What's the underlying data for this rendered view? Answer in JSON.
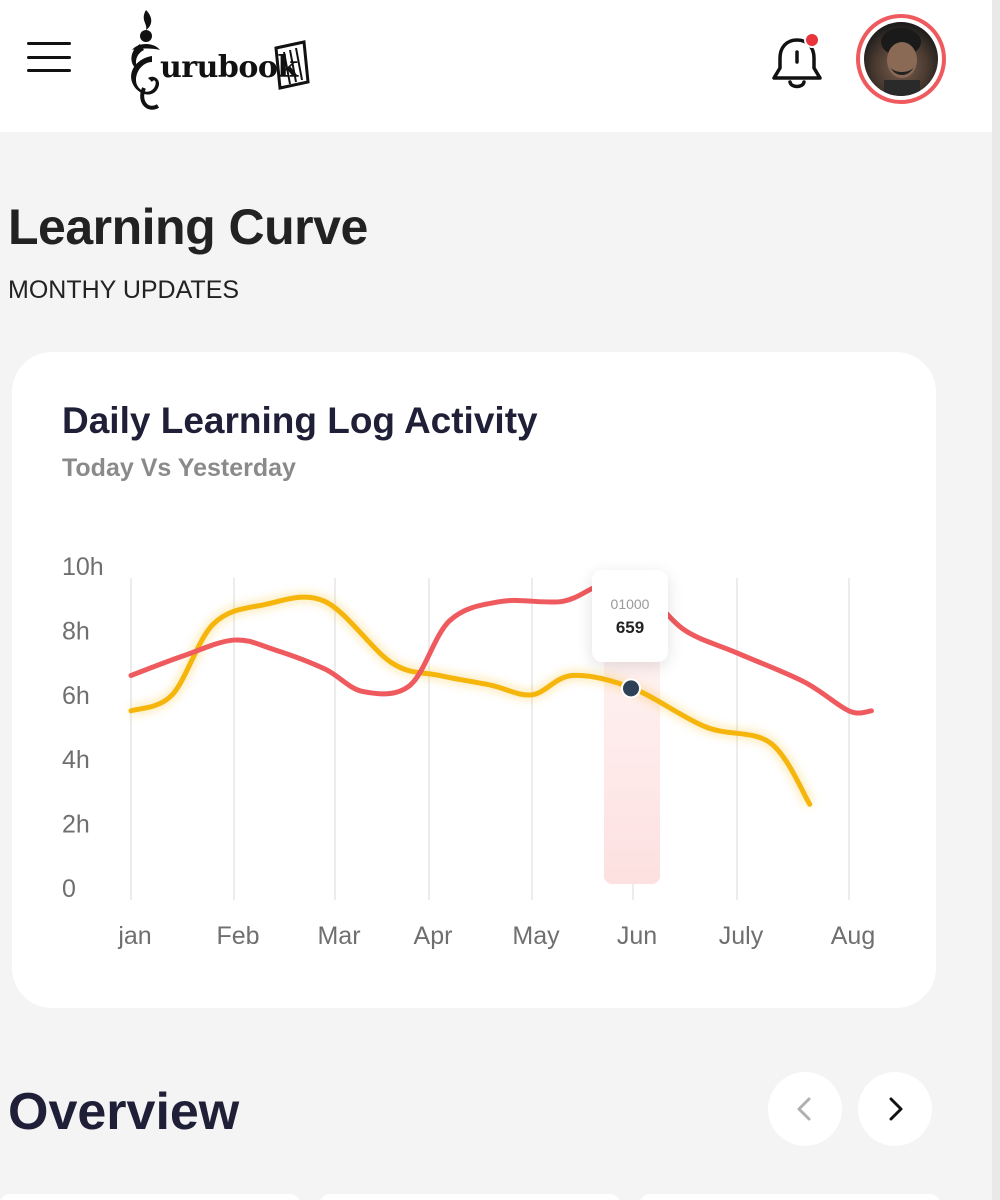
{
  "header": {
    "logo_text": "urubook",
    "has_notification": true
  },
  "page": {
    "title": "Learning Curve",
    "subtitle": "MONTHY UPDATES"
  },
  "card": {
    "title": "Daily Learning Log Activity",
    "subtitle": "Today Vs Yesterday"
  },
  "tooltip": {
    "label": "01000",
    "value": "659"
  },
  "colors": {
    "today": "#f5b50a",
    "yesterday": "#ef5a5e",
    "marker": "#2d4257",
    "highlight": "#fde3e3"
  },
  "chart_data": {
    "type": "line",
    "categories": [
      "jan",
      "Feb",
      "Mar",
      "Apr",
      "May",
      "Jun",
      "July",
      "Aug"
    ],
    "y_tick_labels": [
      "10h",
      "8h",
      "6h",
      "4h",
      "2h",
      "0"
    ],
    "ylim": [
      0,
      10
    ],
    "series": [
      {
        "color": "#f5b50a",
        "points": [
          [
            0,
            5.5
          ],
          [
            0.4,
            6.0
          ],
          [
            0.8,
            8.2
          ],
          [
            1.3,
            8.8
          ],
          [
            1.9,
            8.9
          ],
          [
            2.6,
            7.0
          ],
          [
            3.1,
            6.6
          ],
          [
            3.6,
            6.3
          ],
          [
            4.0,
            6.0
          ],
          [
            4.4,
            6.6
          ],
          [
            5.0,
            6.2
          ],
          [
            5.7,
            5.0
          ],
          [
            6.3,
            4.5
          ],
          [
            6.65,
            2.6
          ]
        ]
      },
      {
        "color": "#ef5a5e",
        "points": [
          [
            0,
            6.6
          ],
          [
            0.5,
            7.2
          ],
          [
            1.0,
            7.7
          ],
          [
            1.4,
            7.4
          ],
          [
            1.9,
            6.8
          ],
          [
            2.3,
            6.1
          ],
          [
            2.8,
            6.3
          ],
          [
            3.2,
            8.3
          ],
          [
            3.7,
            8.9
          ],
          [
            4.3,
            8.9
          ],
          [
            4.7,
            9.4
          ],
          [
            5.1,
            9.2
          ],
          [
            5.5,
            8.0
          ],
          [
            6.0,
            7.3
          ],
          [
            6.6,
            6.4
          ],
          [
            7.0,
            5.5
          ],
          [
            7.2,
            5.5
          ]
        ]
      }
    ],
    "highlight_category": "Jun",
    "marker_value": 6.2,
    "grid": "vertical",
    "legend": "none"
  },
  "overview": {
    "title": "Overview"
  }
}
